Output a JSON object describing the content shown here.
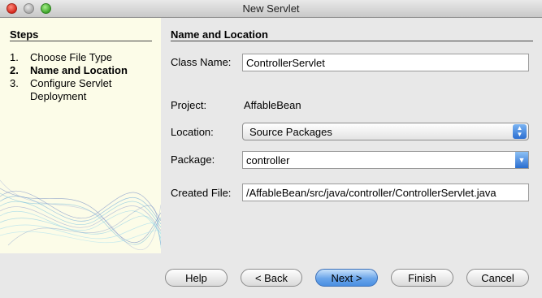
{
  "window": {
    "title": "New Servlet"
  },
  "steps": {
    "title": "Steps",
    "items": [
      {
        "num": "1.",
        "label": "Choose File Type"
      },
      {
        "num": "2.",
        "label": "Name and Location"
      },
      {
        "num": "3.",
        "label": "Configure Servlet"
      },
      {
        "num": "",
        "label": "Deployment"
      }
    ]
  },
  "form": {
    "section_title": "Name and Location",
    "class_name_label": "Class Name:",
    "class_name_value": "ControllerServlet",
    "project_label": "Project:",
    "project_value": "AffableBean",
    "location_label": "Location:",
    "location_value": "Source Packages",
    "package_label": "Package:",
    "package_value": "controller",
    "created_file_label": "Created File:",
    "created_file_value": "/AffableBean/src/java/controller/ControllerServlet.java"
  },
  "buttons": {
    "help": "Help",
    "back": "< Back",
    "next": "Next >",
    "finish": "Finish",
    "cancel": "Cancel"
  },
  "colors": {
    "steps_bg": "#fcfce8",
    "accent": "#4a8fe2"
  }
}
